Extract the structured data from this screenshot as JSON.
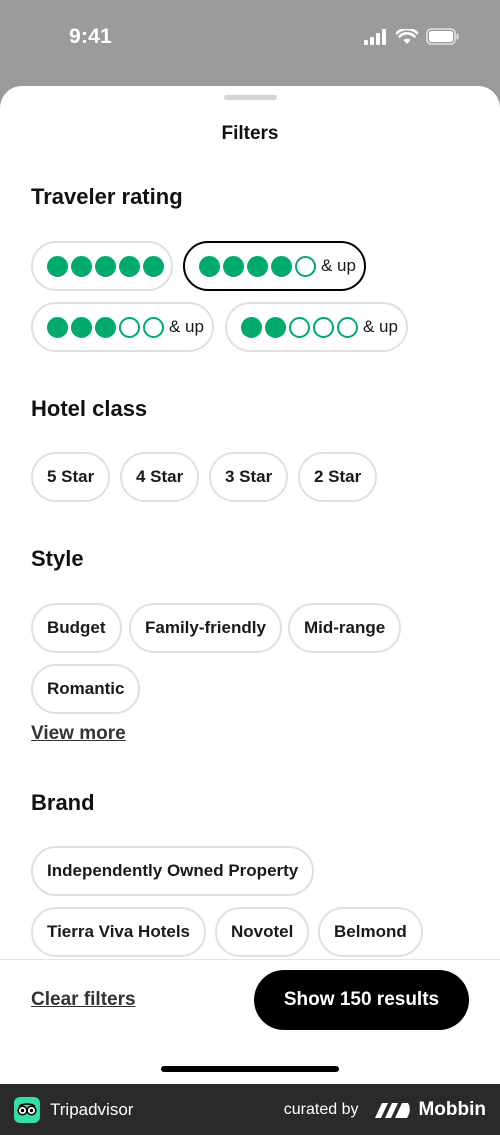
{
  "status_bar": {
    "time": "9:41"
  },
  "sheet": {
    "title": "Filters"
  },
  "traveler_rating": {
    "title": "Traveler rating",
    "options": [
      {
        "filled": 5,
        "total": 5,
        "suffix": ""
      },
      {
        "filled": 4,
        "total": 5,
        "suffix": "& up"
      },
      {
        "filled": 3,
        "total": 5,
        "suffix": "& up"
      },
      {
        "filled": 2,
        "total": 5,
        "suffix": "& up"
      }
    ]
  },
  "hotel_class": {
    "title": "Hotel class",
    "options": [
      "5 Star",
      "4 Star",
      "3 Star",
      "2 Star"
    ]
  },
  "style": {
    "title": "Style",
    "options": [
      "Budget",
      "Family-friendly",
      "Mid-range",
      "Romantic"
    ],
    "view_more": "View more"
  },
  "brand": {
    "title": "Brand",
    "options": [
      "Independently Owned Property",
      "Tierra Viva Hotels",
      "Novotel",
      "Belmond"
    ]
  },
  "footer": {
    "clear_filters": "Clear filters",
    "show_results": "Show 150 results"
  },
  "attribution": {
    "app_name": "Tripadvisor",
    "curated_by": "curated by",
    "source": "Mobbin"
  },
  "colors": {
    "rating_green": "#00aa6c",
    "selected_border": "#000000",
    "pill_border": "#e0e0e0",
    "primary_button": "#000000"
  }
}
